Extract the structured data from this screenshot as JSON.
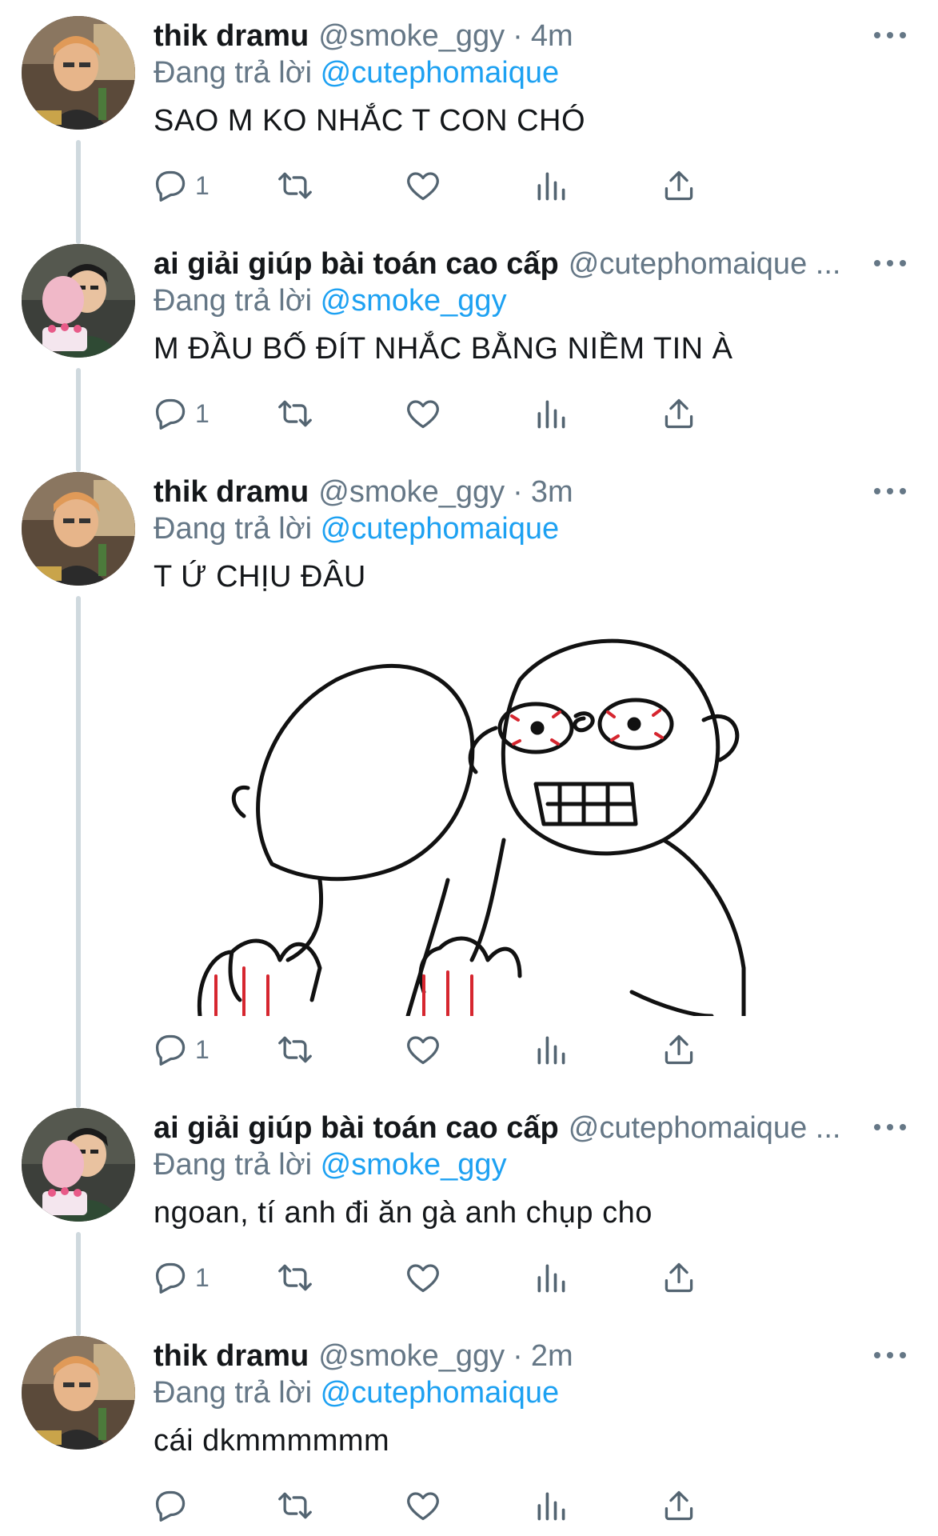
{
  "tweets": [
    {
      "display_name": "thik dramu",
      "handle": "@smoke_ggy",
      "separator": "·",
      "time": "4m",
      "reply_prefix": "Đang trả lời",
      "reply_mention": "@cutephomaique",
      "text": "SAO M KO NHẮC T CON CHÓ",
      "reply_count": "1"
    },
    {
      "display_name": "ai giải giúp bài toán cao cấp",
      "handle": "@cutephomaique ...",
      "reply_prefix": "Đang trả lời",
      "reply_mention": "@smoke_ggy",
      "text": "M ĐẦU BỐ ĐÍT NHẮC BẰNG NIỀM TIN À",
      "reply_count": "1"
    },
    {
      "display_name": "thik dramu",
      "handle": "@smoke_ggy",
      "separator": "·",
      "time": "3m",
      "reply_prefix": "Đang trả lời",
      "reply_mention": "@cutephomaique",
      "text": "T Ứ CHỊU ĐÂU",
      "reply_count": "1"
    },
    {
      "display_name": "ai giải giúp bài toán cao cấp",
      "handle": "@cutephomaique ...",
      "reply_prefix": "Đang trả lời",
      "reply_mention": "@smoke_ggy",
      "text": "ngoan, tí anh đi ăn gà anh chụp cho",
      "reply_count": "1"
    },
    {
      "display_name": "thik dramu",
      "handle": "@smoke_ggy",
      "separator": "·",
      "time": "2m",
      "reply_prefix": "Đang trả lời",
      "reply_mention": "@cutephomaique",
      "text": "cái dkmmmmmm",
      "reply_count": ""
    }
  ],
  "icons": {
    "reply": "reply-icon",
    "retweet": "retweet-icon",
    "like": "heart-icon",
    "analytics": "analytics-icon",
    "share": "share-icon",
    "more": "more-icon"
  },
  "colors": {
    "mention": "#1da1f2",
    "secondary_text": "#657786",
    "thread_line": "#cfd9de",
    "icon": "#536471"
  }
}
